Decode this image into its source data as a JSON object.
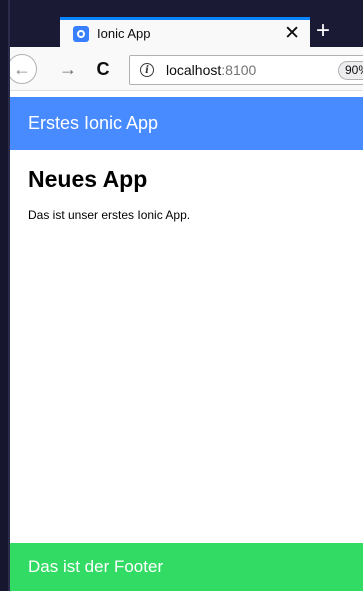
{
  "browser": {
    "tab": {
      "title": "Ionic App",
      "close_glyph": "✕",
      "favicon": "ionic-icon"
    },
    "newtab_glyph": "+",
    "toolbar": {
      "back_glyph": "←",
      "forward_glyph": "→",
      "reload_glyph": "C",
      "url_host": "localhost",
      "url_port": ":8100",
      "info_glyph": "i",
      "zoom": "90%"
    },
    "colors": {
      "tabstrip": "#1a1a35",
      "tab_accent": "#0a84ff"
    }
  },
  "app": {
    "header": {
      "title": "Erstes Ionic App",
      "color": "#488aff"
    },
    "content": {
      "heading": "Neues App",
      "text": "Das ist unser erstes Ionic App."
    },
    "footer": {
      "title": "Das ist der Footer",
      "color": "#32db64"
    }
  }
}
